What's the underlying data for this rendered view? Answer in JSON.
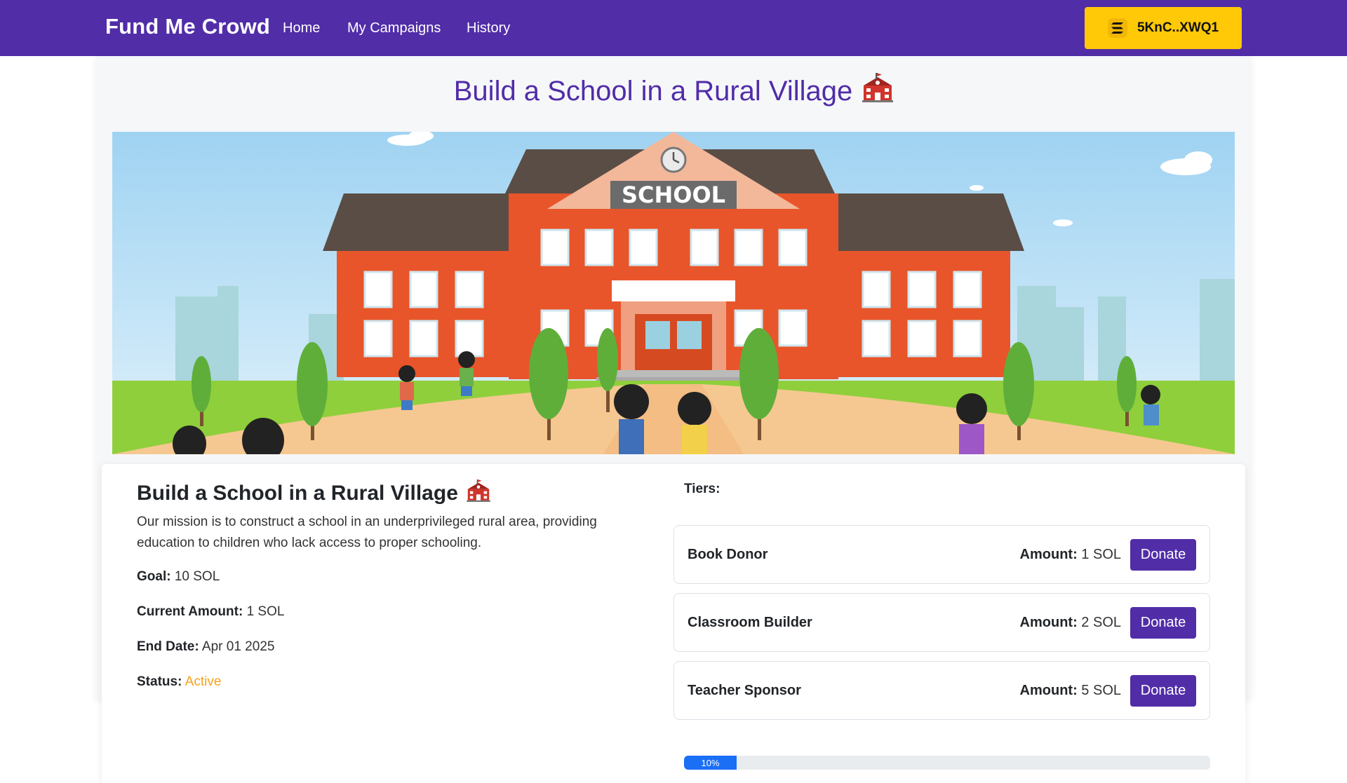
{
  "navbar": {
    "brand": "Fund Me Crowd",
    "links": [
      "Home",
      "My Campaigns",
      "History"
    ],
    "wallet": {
      "address": "5KnC..XWQ1",
      "icon": "solana-icon"
    }
  },
  "page": {
    "title": "Build a School in a Rural Village",
    "title_icon": "school-icon"
  },
  "hero": {
    "sign_text": "SCHOOL",
    "colors": {
      "sky": "#bfe3f7",
      "building": "#e8552a",
      "roof": "#5a4d45",
      "grass": "#8fcf3c"
    }
  },
  "campaign": {
    "title": "Build a School in a Rural Village",
    "description": "Our mission is to construct a school in an underprivileged rural area, providing education to children who lack access to proper schooling.",
    "goal_label": "Goal:",
    "goal_value": "10 SOL",
    "current_label": "Current Amount:",
    "current_value": "1 SOL",
    "end_label": "End Date:",
    "end_value": "Apr 01 2025",
    "status_label": "Status:",
    "status_value": "Active"
  },
  "tiers": {
    "label": "Tiers:",
    "amount_label": "Amount:",
    "donate_label": "Donate",
    "items": [
      {
        "name": "Book Donor",
        "amount": "1 SOL"
      },
      {
        "name": "Classroom Builder",
        "amount": "2 SOL"
      },
      {
        "name": "Teacher Sponsor",
        "amount": "5 SOL"
      }
    ]
  },
  "progress": {
    "percent": 10,
    "label": "10%"
  },
  "colors": {
    "primary": "#512da8",
    "wallet": "#ffc908",
    "status_active": "#f7a21b",
    "progress": "#1a6ff5"
  }
}
